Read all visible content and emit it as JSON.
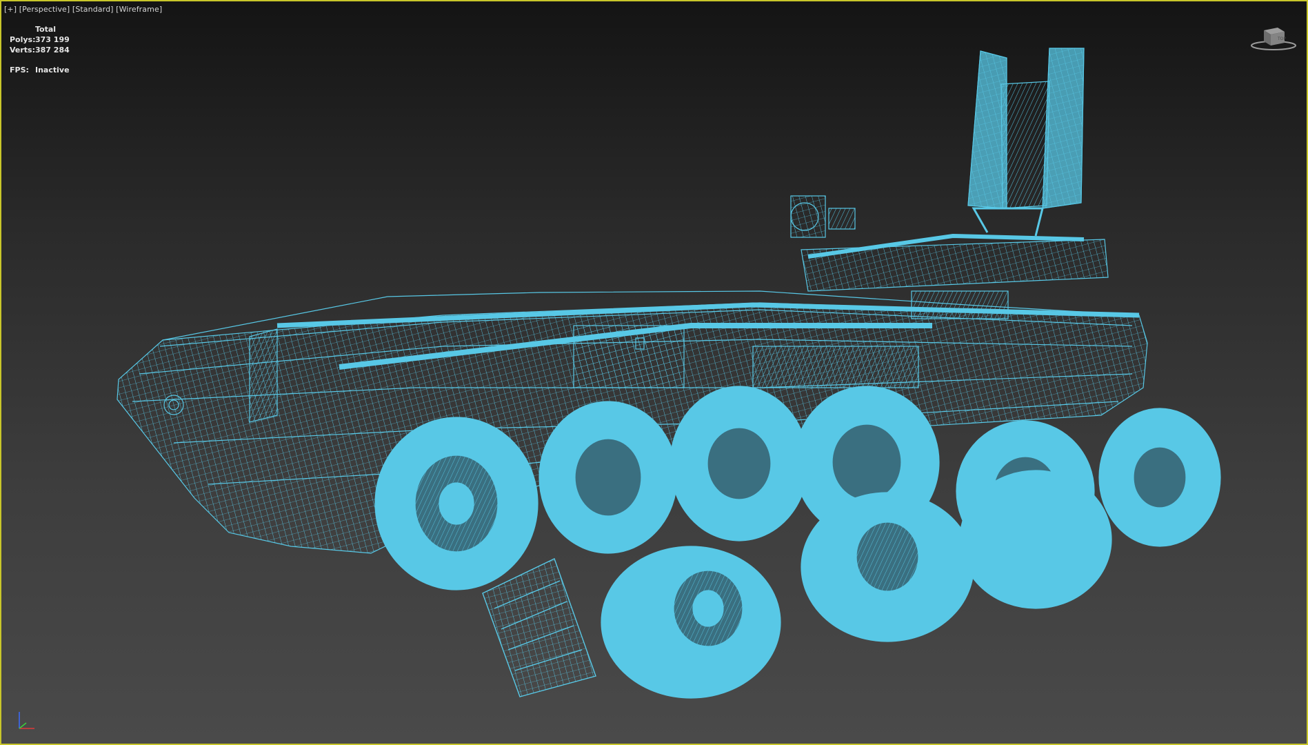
{
  "viewport": {
    "labels": {
      "plus": "[+]",
      "view": "[Perspective]",
      "shading": "[Standard]",
      "style": "[Wireframe]"
    },
    "stats": {
      "header": "Total",
      "polys_label": "Polys:",
      "polys_value": "373 199",
      "verts_label": "Verts:",
      "verts_value": "387 284",
      "fps_label": "FPS:",
      "fps_value": "Inactive"
    },
    "viewcube_face": "TOP",
    "colors": {
      "border": "#c8c62a",
      "wireframe": "#58c8e6",
      "wire_dark": "#1f6a80",
      "text": "#e6e6e6"
    },
    "icons": [
      "viewcube-icon",
      "axis-tripod-icon"
    ]
  }
}
